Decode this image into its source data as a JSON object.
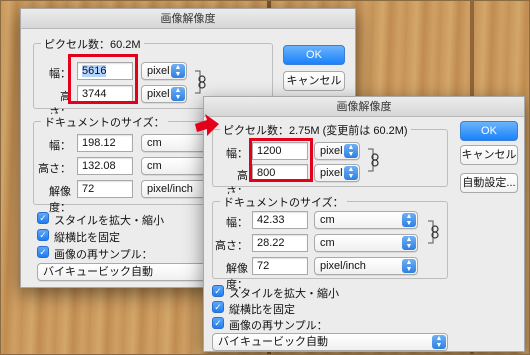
{
  "colors": {
    "accent": "#1a82fb",
    "highlight_box": "#e3001b",
    "arrow": "#e3001b"
  },
  "dialog1": {
    "title": "画像解像度",
    "pixel_group_label": "ピクセル数：60.2M",
    "width_label": "幅：",
    "width_value": "5616",
    "width_unit": "pixel",
    "height_label": "高さ：",
    "height_value": "3744",
    "height_unit": "pixel",
    "ok_label": "OK",
    "cancel_label": "キャンセル",
    "doc_group_label": "ドキュメントのサイズ：",
    "doc_width_label": "幅：",
    "doc_width_value": "198.12",
    "doc_width_unit": "cm",
    "doc_height_label": "高さ：",
    "doc_height_value": "132.08",
    "doc_height_unit": "cm",
    "resolution_label": "解像度：",
    "resolution_value": "72",
    "resolution_unit": "pixel/inch",
    "scale_styles_label": "スタイルを拡大・縮小",
    "constrain_label": "縦横比を固定",
    "resample_label": "画像の再サンプル：",
    "resample_method": "バイキュービック自動"
  },
  "dialog2": {
    "title": "画像解像度",
    "pixel_group_label": "ピクセル数：2.75M (変更前は 60.2M)",
    "width_label": "幅：",
    "width_value": "1200",
    "width_unit": "pixel",
    "height_label": "高さ：",
    "height_value": "800",
    "height_unit": "pixel",
    "ok_label": "OK",
    "cancel_label": "キャンセル",
    "auto_label": "自動設定...",
    "doc_group_label": "ドキュメントのサイズ：",
    "doc_width_label": "幅：",
    "doc_width_value": "42.33",
    "doc_width_unit": "cm",
    "doc_height_label": "高さ：",
    "doc_height_value": "28.22",
    "doc_height_unit": "cm",
    "resolution_label": "解像度：",
    "resolution_value": "72",
    "resolution_unit": "pixel/inch",
    "scale_styles_label": "スタイルを拡大・縮小",
    "constrain_label": "縦横比を固定",
    "resample_label": "画像の再サンプル：",
    "resample_method": "バイキュービック自動"
  },
  "icons": {
    "check": "✓",
    "caret_up": "▲",
    "caret_down": "▼"
  }
}
